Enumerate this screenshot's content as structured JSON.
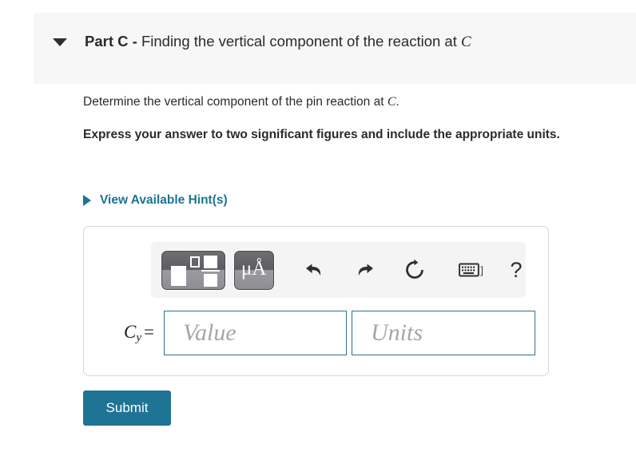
{
  "part_header": {
    "caret_icon": "caret-down-icon",
    "label": "Part C",
    "dash": " - ",
    "description": "Finding the vertical component of the reaction at ",
    "description_var": "C"
  },
  "body": {
    "prompt_text": "Determine the vertical component of the pin reaction at ",
    "prompt_var": "C",
    "prompt_end": ".",
    "instruction": "Express your answer to two significant figures and include the appropriate units."
  },
  "hints": {
    "caret_icon": "caret-right-icon",
    "label": "View Available Hint(s)"
  },
  "toolbar": {
    "template_button": {
      "icon": "math-template-icon",
      "title": "Templates"
    },
    "units_button": {
      "icon": "micro-angstrom-icon",
      "label": "μÅ",
      "title": "Units"
    },
    "undo": {
      "icon": "undo-icon",
      "title": "Undo"
    },
    "redo": {
      "icon": "redo-icon",
      "title": "Redo"
    },
    "reset": {
      "icon": "reset-icon",
      "title": "Reset"
    },
    "keyboard": {
      "icon": "keyboard-icon",
      "title": "Keyboard shortcuts",
      "bracket": "]"
    },
    "help": {
      "icon": "help-icon",
      "label": "?",
      "title": "Help"
    }
  },
  "answer": {
    "variable": "C",
    "subscript": "y",
    "equals": "=",
    "value_field": {
      "placeholder": "Value",
      "value": ""
    },
    "units_field": {
      "placeholder": "Units",
      "value": ""
    }
  },
  "actions": {
    "submit_label": "Submit"
  },
  "colors": {
    "accent_teal": "#1c7495",
    "submit_bg": "#1f7496",
    "field_border": "#31708f",
    "header_band": "#f7f7f8",
    "toolbar_bg": "#f4f4f4",
    "panel_border": "#d6d6d6",
    "text": "#2b2b2b",
    "placeholder": "#a6a6a6"
  }
}
